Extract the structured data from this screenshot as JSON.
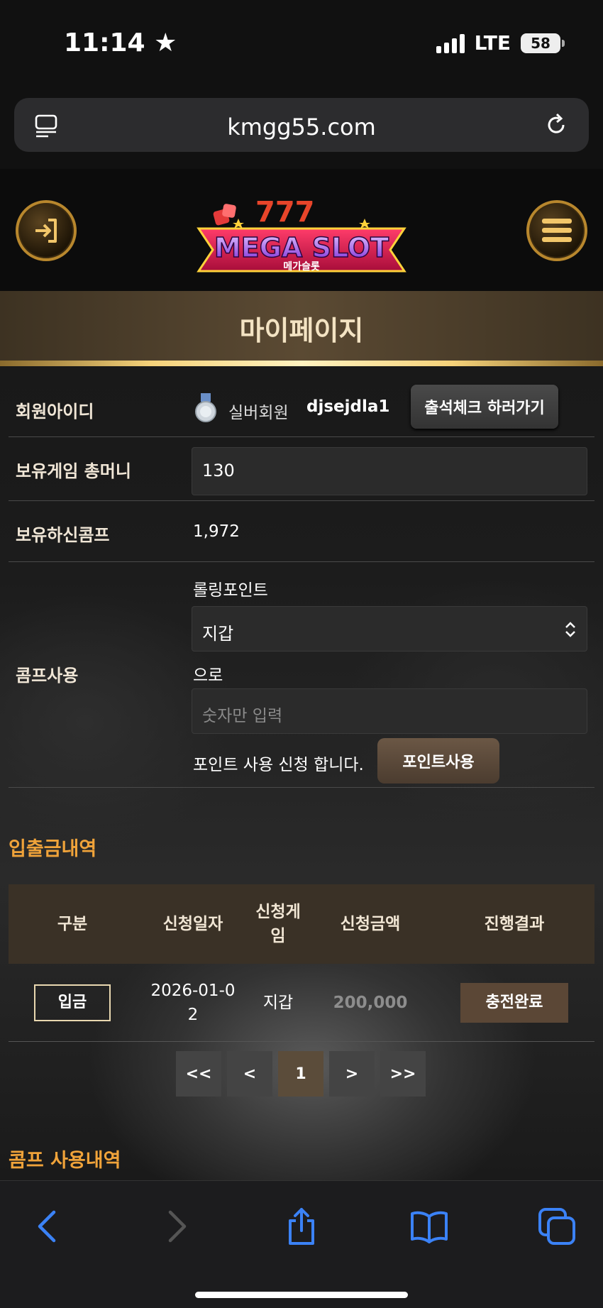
{
  "status_bar": {
    "time": "11:14",
    "network": "LTE",
    "battery": "58"
  },
  "browser": {
    "url": "kmgg55.com"
  },
  "header": {
    "logo_text": "MEGA SLOT",
    "logo_subtext": "메가슬롯"
  },
  "page_title": "마이페이지",
  "profile": {
    "member_id_label": "회원아이디",
    "member_level": "실버회원",
    "member_id": "djsejdla1",
    "attendance_button": "출석체크 하러가기",
    "money_label": "보유게임 총머니",
    "money_value": "130",
    "comp_label": "보유하신콤프",
    "comp_value": "1,972",
    "comp_use_label": "콤프사용",
    "rolling_point_label": "롤링포인트",
    "wallet_select_value": "지갑",
    "to_label": "으로",
    "amount_placeholder": "숫자만 입력",
    "apply_text": "포인트 사용 신청 합니다.",
    "use_point_button": "포인트사용"
  },
  "transactions": {
    "title": "입출금내역",
    "headers": [
      "구분",
      "신청일자",
      "신청게임",
      "신청금액",
      "진행결과"
    ],
    "rows": [
      {
        "type": "입금",
        "date": "2026-01-02",
        "game": "지갑",
        "amount": "200,000",
        "status": "충전완료"
      }
    ]
  },
  "pagination": {
    "first": "<<",
    "prev": "<",
    "current": "1",
    "next": ">",
    "last": ">>"
  },
  "comp_history": {
    "title": "콤프 사용내역"
  },
  "colors": {
    "accent_gold": "#f0a33a",
    "header_brown": "#3a3126",
    "button_brown": "#5b4736"
  }
}
